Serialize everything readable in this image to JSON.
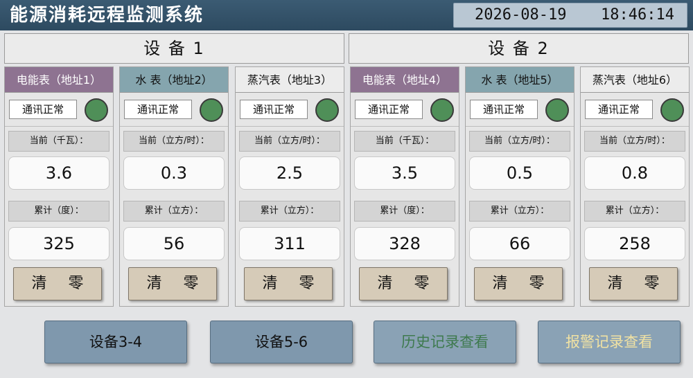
{
  "app": {
    "title": "能源消耗远程监测系统",
    "date": "2026-08-19",
    "time": "18:46:14"
  },
  "groups": [
    {
      "title": "设 备 1"
    },
    {
      "title": "设 备 2"
    }
  ],
  "panels": [
    {
      "title": "电能表（地址1）",
      "type": "electric",
      "status": "通讯正常",
      "current_label": "当前（千瓦）：",
      "current_value": "3.6",
      "total_label": "累计（度）：",
      "total_value": "325",
      "clear_label": "清 零"
    },
    {
      "title": "水 表（地址2）",
      "type": "water",
      "status": "通讯正常",
      "current_label": "当前（立方/时）：",
      "current_value": "0.3",
      "total_label": "累计（立方）：",
      "total_value": "56",
      "clear_label": "清 零"
    },
    {
      "title": "蒸汽表（地址3）",
      "type": "steam",
      "status": "通讯正常",
      "current_label": "当前（立方/时）：",
      "current_value": "2.5",
      "total_label": "累计（立方）：",
      "total_value": "311",
      "clear_label": "清 零"
    },
    {
      "title": "电能表（地址4）",
      "type": "electric",
      "status": "通讯正常",
      "current_label": "当前（千瓦）：",
      "current_value": "3.5",
      "total_label": "累计（度）：",
      "total_value": "328",
      "clear_label": "清 零"
    },
    {
      "title": "水 表（地址5）",
      "type": "water",
      "status": "通讯正常",
      "current_label": "当前（立方/时）：",
      "current_value": "0.5",
      "total_label": "累计（立方）：",
      "total_value": "66",
      "clear_label": "清 零"
    },
    {
      "title": "蒸汽表（地址6）",
      "type": "steam",
      "status": "通讯正常",
      "current_label": "当前（立方/时）：",
      "current_value": "0.8",
      "total_label": "累计（立方）：",
      "total_value": "258",
      "clear_label": "清 零"
    }
  ],
  "nav": {
    "devices_3_4": "设备3-4",
    "devices_5_6": "设备5-6",
    "history": "历史记录查看",
    "alarms": "报警记录查看"
  },
  "colors": {
    "status_led": "#4f8f58",
    "electric_header": "#8e7391",
    "water_header": "#85a5ae",
    "history_text": "#3e7a4e",
    "alarm_text": "#f1e2a3"
  }
}
